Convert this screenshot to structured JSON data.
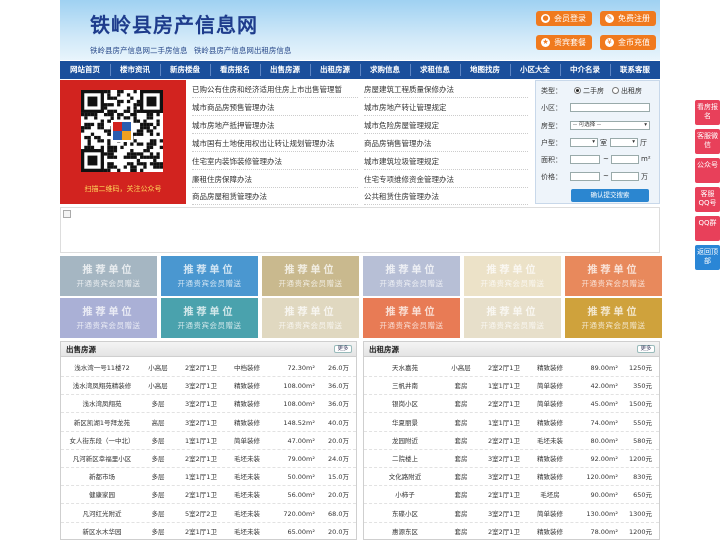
{
  "header": {
    "title": "铁岭县房产信息网",
    "subtitle": "铁岭县房产信息网二手房信息 铁岭县房产信息网出租房信息",
    "buttons": [
      {
        "label": "会员登录",
        "icon": "user-icon"
      },
      {
        "label": "免费注册",
        "icon": "edit-icon"
      },
      {
        "label": "贵宾套餐",
        "icon": "vip-icon"
      },
      {
        "label": "金币充值",
        "icon": "coin-icon"
      }
    ]
  },
  "nav": [
    "网站首页",
    "楼市资讯",
    "新房楼盘",
    "看房报名",
    "出售房源",
    "出租房源",
    "求购信息",
    "求租信息",
    "地图找房",
    "小区大全",
    "中介名录",
    "联系客服"
  ],
  "qr": {
    "caption": "扫描二维码，关注公众号"
  },
  "links": {
    "left": [
      "已购公有住房和经济适用住房上市出售管理暂",
      "城市商品房预售管理办法",
      "城市房地产抵押管理办法",
      "城市国有土地使用权出让转让规划管理办法",
      "住宅室内装饰装修管理办法",
      "廉租住房保障办法",
      "商品房屋租赁管理办法"
    ],
    "right": [
      "房屋建筑工程质量保修办法",
      "城市房地产转让管理规定",
      "城市危险房屋管理规定",
      "商品房销售管理办法",
      "城市建筑垃圾管理规定",
      "住宅专项维修资金管理办法",
      "公共租赁住房管理办法"
    ]
  },
  "search": {
    "type_label": "类型：",
    "type_options": [
      "二手房",
      "出租房"
    ],
    "community_label": "小区：",
    "layout_label": "房型：",
    "layout_value": "-- 可选择 --",
    "rooms_label": "户型：",
    "room_unit": "室",
    "hall_unit": "厅",
    "area_label": "面积：",
    "area_unit": "m²",
    "price_label": "价格：",
    "price_unit": "万",
    "range_sep": "~",
    "submit": "确认提交搜索"
  },
  "ads": {
    "title": "推荐单位",
    "subtitle": "开通贵宾会员赠送",
    "colors": [
      "#a5b6c2",
      "#4a97d0",
      "#c9b98e",
      "#b7bfd6",
      "#ece2c8",
      "#e8895c",
      "#aab0d6",
      "#4aa2ad",
      "#e0d8c0",
      "#e87b55",
      "#e7dfca",
      "#cfa23c"
    ]
  },
  "sale": {
    "title": "出售房源",
    "more": "更多",
    "rows": [
      [
        "浅水湾一号11楼72",
        "小高层",
        "2室2厅1卫",
        "中档装修",
        "72.30m²",
        "26.0万"
      ],
      [
        "浅水湾凤翔苑精装修",
        "小高层",
        "3室2厅1卫",
        "精致装修",
        "108.00m²",
        "36.0万"
      ],
      [
        "浅水湾凤翔苑",
        "多层",
        "3室2厅1卫",
        "精致装修",
        "108.00m²",
        "36.0万"
      ],
      [
        "新区凯湖1号拜龙苑",
        "高层",
        "3室2厅1卫",
        "精致装修",
        "148.52m²",
        "40.0万"
      ],
      [
        "女人街东段（一中北）",
        "多层",
        "1室1厅1卫",
        "简单装修",
        "47.00m²",
        "20.0万"
      ],
      [
        "凡河新区幸福里小区",
        "多层",
        "2室2厅1卫",
        "毛坯未装",
        "79.00m²",
        "24.0万"
      ],
      [
        "新都市场",
        "多层",
        "1室1厅1卫",
        "毛坯未装",
        "50.00m²",
        "15.0万"
      ],
      [
        "健康家园",
        "多层",
        "2室1厅1卫",
        "毛坯未装",
        "56.00m²",
        "20.0万"
      ],
      [
        "凡河红光附近",
        "多层",
        "5室2厅2卫",
        "毛坯未装",
        "720.00m²",
        "68.0万"
      ],
      [
        "新区水木华园",
        "多层",
        "2室1厅1卫",
        "毛坯未装",
        "65.00m²",
        "20.0万"
      ]
    ]
  },
  "rent": {
    "title": "出租房源",
    "more": "更多",
    "rows": [
      [
        "天水嘉苑",
        "小高层",
        "2室2厅1卫",
        "精致装修",
        "89.00m²",
        "1250元"
      ],
      [
        "三帆井南",
        "套房",
        "1室1厅1卫",
        "简单装修",
        "42.00m²",
        "350元"
      ],
      [
        "银岗小区",
        "套房",
        "2室2厅1卫",
        "简单装修",
        "45.00m²",
        "1500元"
      ],
      [
        "华夏丽景",
        "套房",
        "1室1厅1卫",
        "精致装修",
        "74.00m²",
        "550元"
      ],
      [
        "龙园附近",
        "套房",
        "2室2厅1卫",
        "毛坯未装",
        "80.00m²",
        "580元"
      ],
      [
        "二院楼上",
        "套房",
        "3室2厅1卫",
        "精致装修",
        "92.00m²",
        "1200元"
      ],
      [
        "文化路附近",
        "套房",
        "3室2厅1卫",
        "精致装修",
        "120.00m²",
        "830元"
      ],
      [
        "小柿子",
        "套房",
        "2室1厅1卫",
        "毛坯房",
        "90.00m²",
        "650元"
      ],
      [
        "东碟小区",
        "套房",
        "3室2厅1卫",
        "简单装修",
        "130.00m²",
        "1300元"
      ],
      [
        "惠源东区",
        "套房",
        "2室2厅1卫",
        "精致装修",
        "78.00m²",
        "1200元"
      ]
    ]
  },
  "float_bar": [
    "看房报名",
    "客服微信",
    "公众号",
    "客服QQ号",
    "QQ群",
    "返回顶部"
  ]
}
